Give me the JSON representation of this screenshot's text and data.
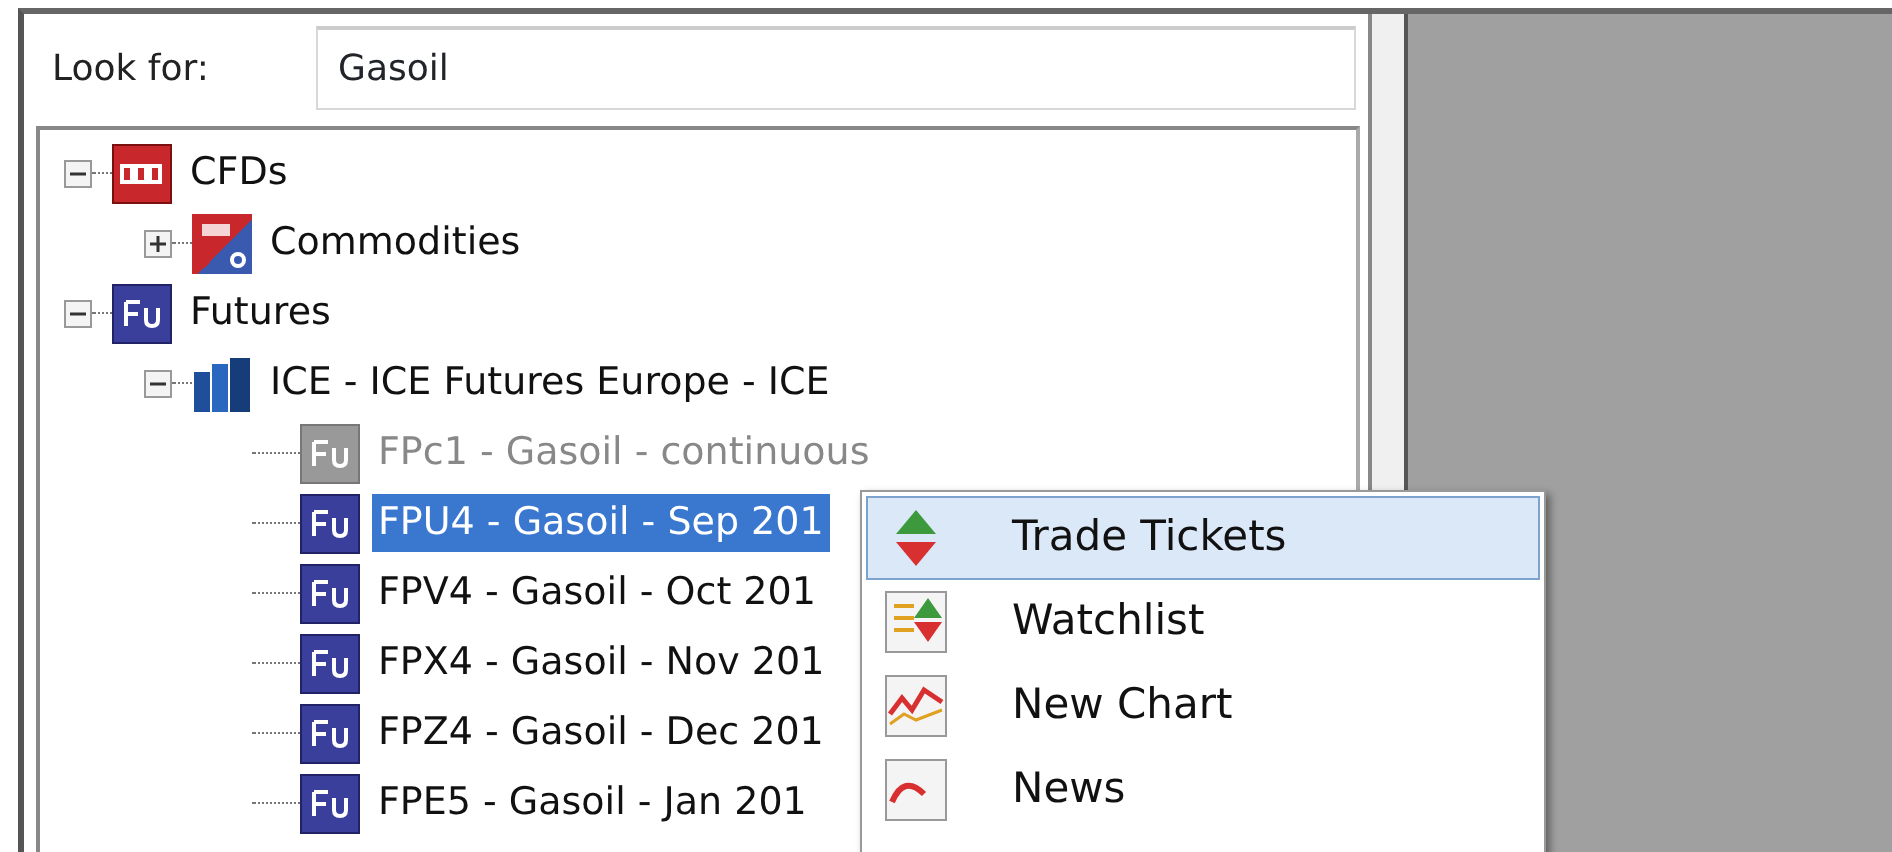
{
  "search": {
    "label": "Look for:",
    "value": "Gasoil"
  },
  "tree": [
    {
      "label": "CFDs",
      "kind": "cfd",
      "expanded": true,
      "selected": false,
      "disabled": false,
      "children": [
        {
          "label": "Commodities",
          "kind": "cfd-c",
          "expanded": false,
          "selected": false,
          "disabled": false
        }
      ]
    },
    {
      "label": "Futures",
      "kind": "fu",
      "expanded": true,
      "selected": false,
      "disabled": false,
      "children": [
        {
          "label": "ICE - ICE Futures Europe - ICE",
          "kind": "exchange",
          "expanded": true,
          "selected": false,
          "disabled": false,
          "children": [
            {
              "label": "FPc1 - Gasoil - continuous",
              "kind": "fu",
              "selected": false,
              "disabled": true
            },
            {
              "label": "FPU4 - Gasoil - Sep 201",
              "kind": "fu",
              "selected": true,
              "disabled": false
            },
            {
              "label": "FPV4 - Gasoil - Oct 201",
              "kind": "fu",
              "selected": false,
              "disabled": false
            },
            {
              "label": "FPX4 - Gasoil - Nov 201",
              "kind": "fu",
              "selected": false,
              "disabled": false
            },
            {
              "label": "FPZ4 - Gasoil - Dec 201",
              "kind": "fu",
              "selected": false,
              "disabled": false
            },
            {
              "label": "FPE5 - Gasoil - Jan 201",
              "kind": "fu",
              "selected": false,
              "disabled": false
            }
          ]
        }
      ]
    }
  ],
  "context_menu": [
    {
      "label": "Trade Tickets",
      "kind": "trade",
      "selected": true
    },
    {
      "label": "Watchlist",
      "kind": "watchlist",
      "selected": false
    },
    {
      "label": "New Chart",
      "kind": "chart",
      "selected": false
    },
    {
      "label": "News",
      "kind": "news",
      "selected": false
    }
  ]
}
